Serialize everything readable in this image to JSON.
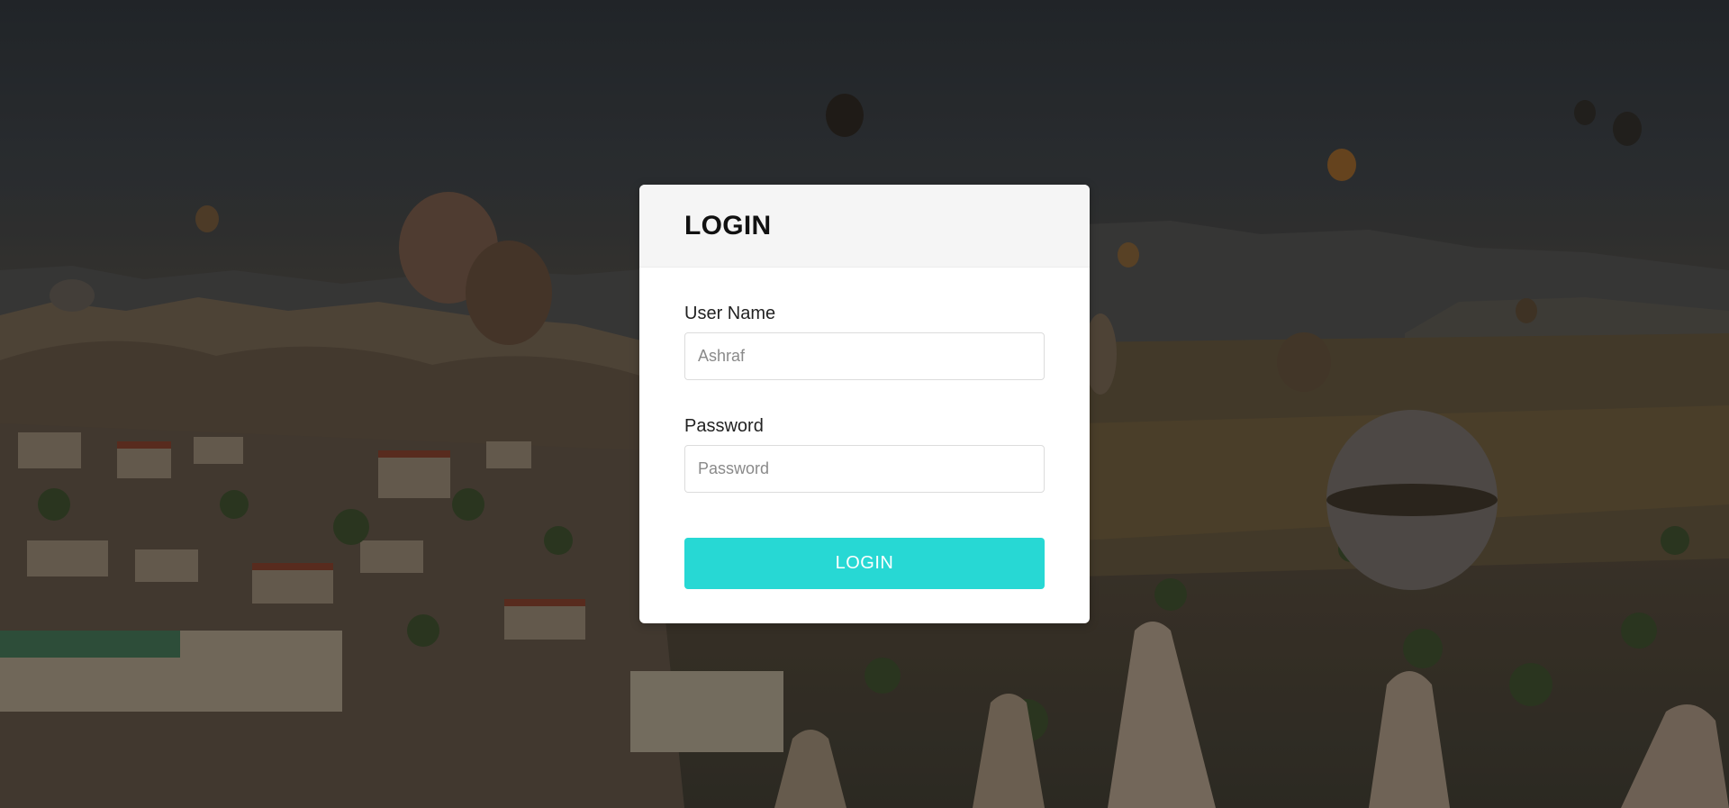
{
  "login": {
    "title": "LOGIN",
    "username_label": "User Name",
    "username_placeholder": "Ashraf",
    "password_label": "Password",
    "password_placeholder": "Password",
    "submit_label": "LOGIN"
  },
  "theme": {
    "accent": "#27d8d4",
    "header_bg": "#f5f5f5",
    "card_bg": "#ffffff"
  }
}
